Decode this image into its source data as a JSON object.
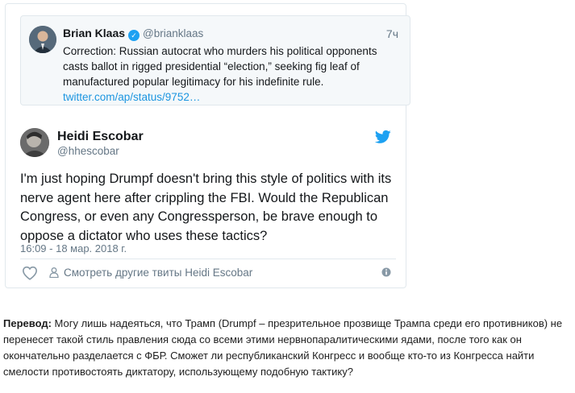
{
  "quoted_tweet": {
    "author_name": "Brian Klaas",
    "author_handle": "@brianklaas",
    "time": "7ч",
    "text": "Correction: Russian autocrat who murders his political opponents casts ballot in rigged presidential “election,” seeking fig leaf of manufactured popular legitimacy for his indefinite rule.",
    "link": "twitter.com/ap/status/9752…"
  },
  "tweet": {
    "author_name": "Heidi Escobar",
    "author_handle": "@hhescobar",
    "text": "I'm just hoping Drumpf doesn't bring this style of politics with its nerve agent here after crippling the FBI. Would the Republican Congress, or even any Congressperson, be brave enough to oppose a dictator who uses these tactics?",
    "timestamp": "16:09 - 18 мар. 2018 г.",
    "more_tweets_label": "Смотреть другие твиты Heidi Escobar"
  },
  "translation": {
    "label": "Перевод:",
    "text": " Могу лишь надеяться, что Трамп (Drumpf – презрительное прозвище Трампа среди его противников) не перенесет такой стиль правления сюда со всеми этими нервнопаралитическими ядами, после того как он окончательно разделается с ФБР. Сможет ли республиканский Конгресс и вообще кто-то из Конгресса найти смелости противостоять диктатору, использующему подобную тактику?"
  },
  "icons": {
    "verified": "verified-badge-icon",
    "twitter": "twitter-bird-icon",
    "like": "heart-icon",
    "profile": "person-icon",
    "info": "info-icon"
  },
  "colors": {
    "twitter_blue": "#1da1f2",
    "link_blue": "#1b95e0",
    "secondary_text": "#657786",
    "border": "#e1e8ed"
  }
}
